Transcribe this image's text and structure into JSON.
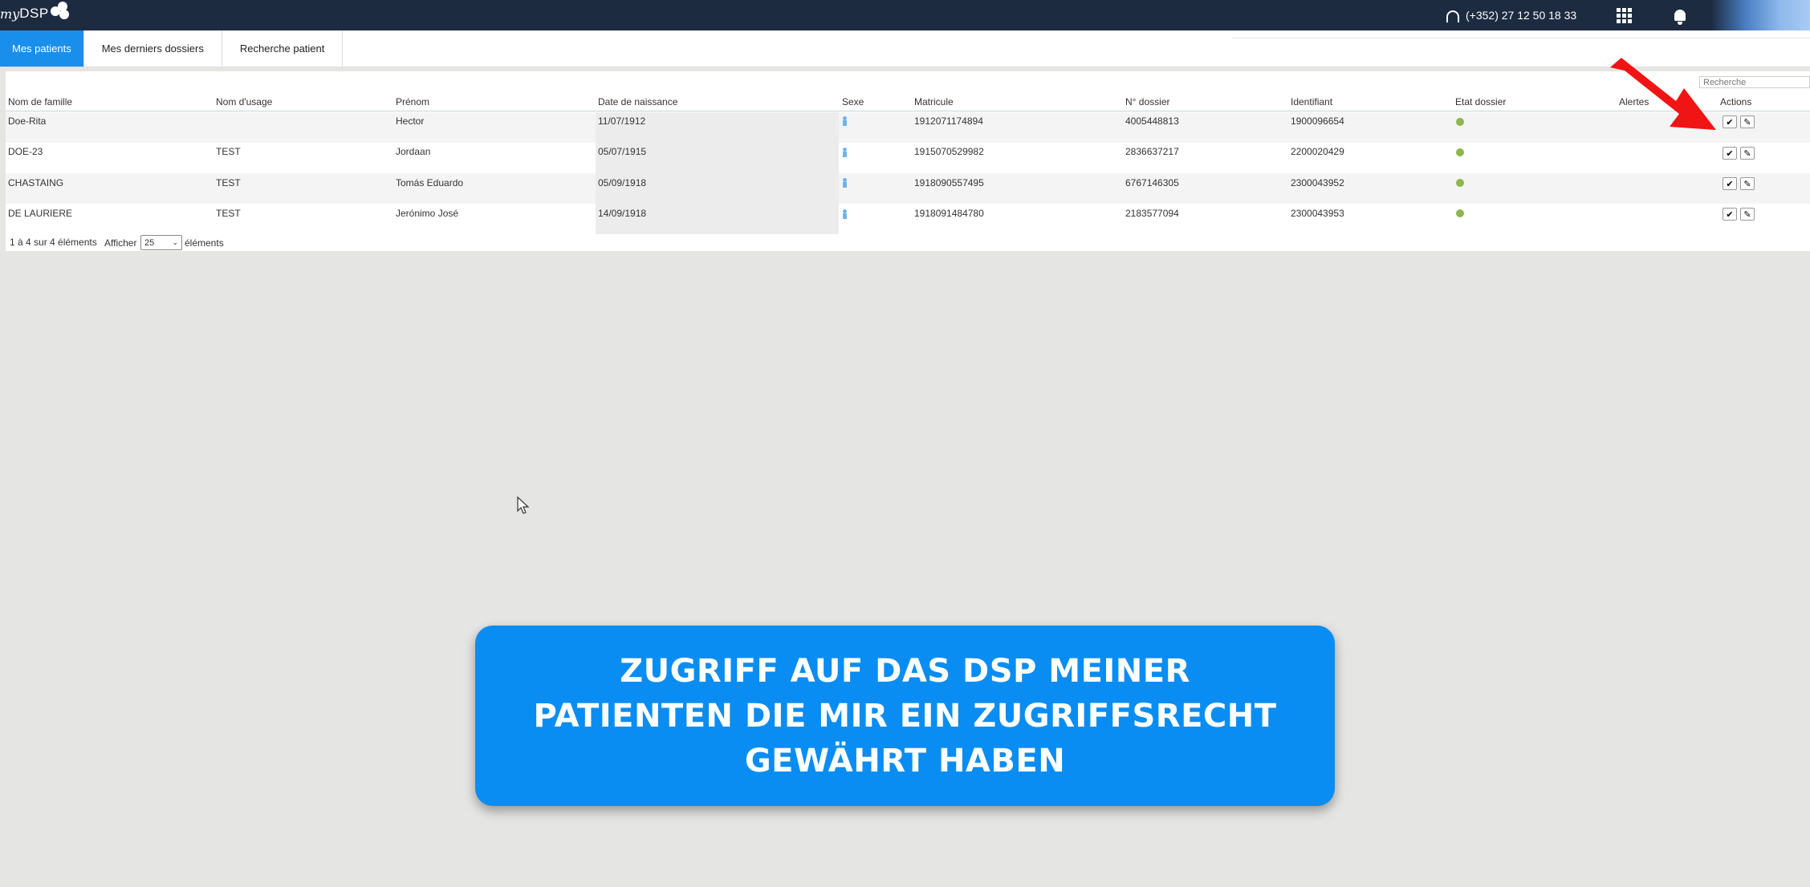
{
  "app": {
    "logo_my": "my",
    "logo_dsp": "DSP"
  },
  "topbar": {
    "phone": "(+352) 27 12 50 18 33"
  },
  "tabs": [
    {
      "label": "Mes patients",
      "active": true
    },
    {
      "label": "Mes derniers dossiers",
      "active": false
    },
    {
      "label": "Recherche patient",
      "active": false
    }
  ],
  "search": {
    "placeholder": "Recherche"
  },
  "table": {
    "headers": {
      "nom_famille": "Nom de famille",
      "nom_usage": "Nom d'usage",
      "prenom": "Prénom",
      "date_naissance": "Date de naissance",
      "sexe": "Sexe",
      "matricule": "Matricule",
      "n_dossier": "N° dossier",
      "identifiant": "Identifiant",
      "etat_dossier": "Etat dossier",
      "alertes": "Alertes",
      "actions": "Actions"
    },
    "rows": [
      {
        "nom_famille": "Doe-Rita",
        "nom_usage": "",
        "prenom": "Hector",
        "date_naissance": "11/07/1912",
        "matricule": "1912071174894",
        "n_dossier": "4005448813",
        "identifiant": "1900096654"
      },
      {
        "nom_famille": "DOE-23",
        "nom_usage": "TEST",
        "prenom": "Jordaan",
        "date_naissance": "05/07/1915",
        "matricule": "1915070529982",
        "n_dossier": "2836637217",
        "identifiant": "2200020429"
      },
      {
        "nom_famille": "CHASTAING",
        "nom_usage": "TEST",
        "prenom": "Tomás Eduardo",
        "date_naissance": "05/09/1918",
        "matricule": "1918090557495",
        "n_dossier": "6767146305",
        "identifiant": "2300043952"
      },
      {
        "nom_famille": "DE LAURIERE",
        "nom_usage": "TEST",
        "prenom": "Jerónimo José",
        "date_naissance": "14/09/1918",
        "matricule": "1918091484780",
        "n_dossier": "2183577094",
        "identifiant": "2300043953"
      }
    ]
  },
  "footer": {
    "info": "1 à 4 sur 4 éléments",
    "show_label": "Afficher",
    "page_size": "25",
    "elements_label": "éléments"
  },
  "colors": {
    "topbar": "#1d2b40",
    "accent": "#1a8eeb",
    "status_ok": "#8db64d",
    "banner": "#0a8df2",
    "arrow": "#f01414"
  },
  "banner": {
    "line1": "ZUGRIFF AUF DAS DSP MEINER",
    "line2": "PATIENTEN DIE MIR EIN ZUGRIFFSRECHT",
    "line3": "GEWÄHRT HABEN"
  }
}
